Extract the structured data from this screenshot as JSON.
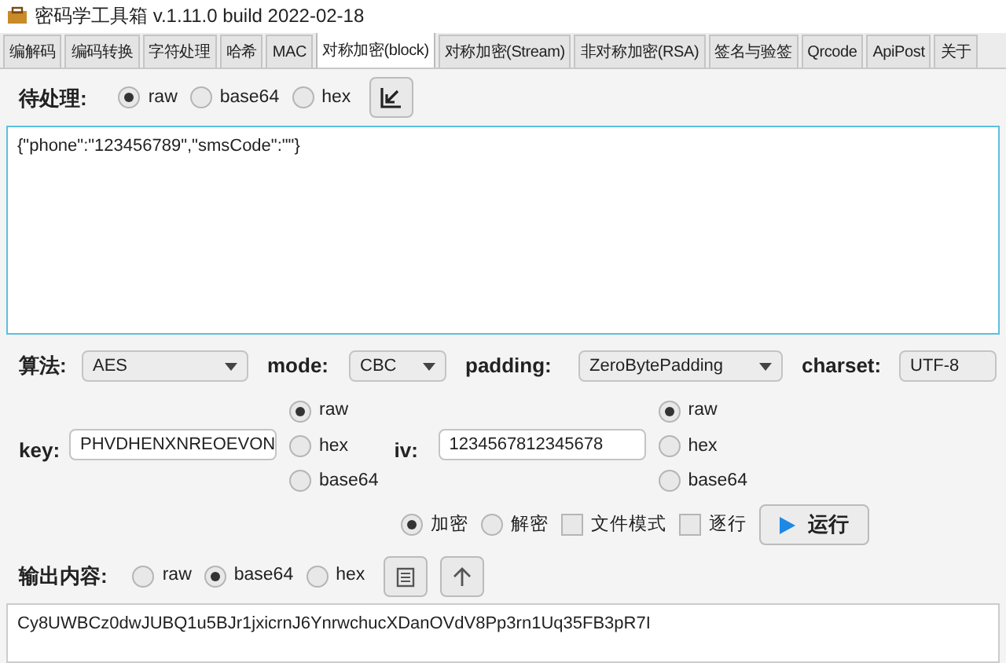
{
  "window": {
    "title": "密码学工具箱 v.1.11.0 build 2022-02-18"
  },
  "tabs": [
    {
      "label": "编解码",
      "selected": false
    },
    {
      "label": "编码转换",
      "selected": false
    },
    {
      "label": "字符处理",
      "selected": false
    },
    {
      "label": "哈希",
      "selected": false
    },
    {
      "label": "MAC",
      "selected": false
    },
    {
      "label": "对称加密(block)",
      "selected": true
    },
    {
      "label": "对称加密(Stream)",
      "selected": false
    },
    {
      "label": "非对称加密(RSA)",
      "selected": false
    },
    {
      "label": "签名与验签",
      "selected": false
    },
    {
      "label": "Qrcode",
      "selected": false
    },
    {
      "label": "ApiPost",
      "selected": false
    },
    {
      "label": "关于",
      "selected": false
    }
  ],
  "input": {
    "label": "待处理:",
    "formats": [
      {
        "label": "raw",
        "selected": true
      },
      {
        "label": "base64",
        "selected": false
      },
      {
        "label": "hex",
        "selected": false
      }
    ],
    "value": "{\"phone\":\"123456789\",\"smsCode\":\"\"}"
  },
  "settings": [
    {
      "label": "算法:",
      "value": "AES"
    },
    {
      "label": "mode:",
      "value": "CBC"
    },
    {
      "label": "padding:",
      "value": "ZeroBytePadding"
    },
    {
      "label": "charset:",
      "value": "UTF-8"
    }
  ],
  "key": {
    "label": "key:",
    "value": "PHVDHENXNREOEVON",
    "formats": [
      {
        "label": "raw",
        "selected": true
      },
      {
        "label": "hex",
        "selected": false
      },
      {
        "label": "base64",
        "selected": false
      }
    ]
  },
  "iv": {
    "label": "iv:",
    "value": "1234567812345678",
    "formats": [
      {
        "label": "raw",
        "selected": true
      },
      {
        "label": "hex",
        "selected": false
      },
      {
        "label": "base64",
        "selected": false
      }
    ]
  },
  "actions": {
    "modes": [
      {
        "label": "加密",
        "selected": true
      },
      {
        "label": "解密",
        "selected": false
      }
    ],
    "options": [
      {
        "label": "文件模式",
        "checked": false
      },
      {
        "label": "逐行",
        "checked": false
      }
    ],
    "run_button": "运行"
  },
  "output": {
    "label": "输出内容:",
    "formats": [
      {
        "label": "raw",
        "selected": false
      },
      {
        "label": "base64",
        "selected": true
      },
      {
        "label": "hex",
        "selected": false
      }
    ],
    "value": "Cy8UWBCz0dwJUBQ1u5BJr1jxicrnJ6YnrwchucXDanOVdV8Pp3rn1Uq35FB3pR7I"
  }
}
